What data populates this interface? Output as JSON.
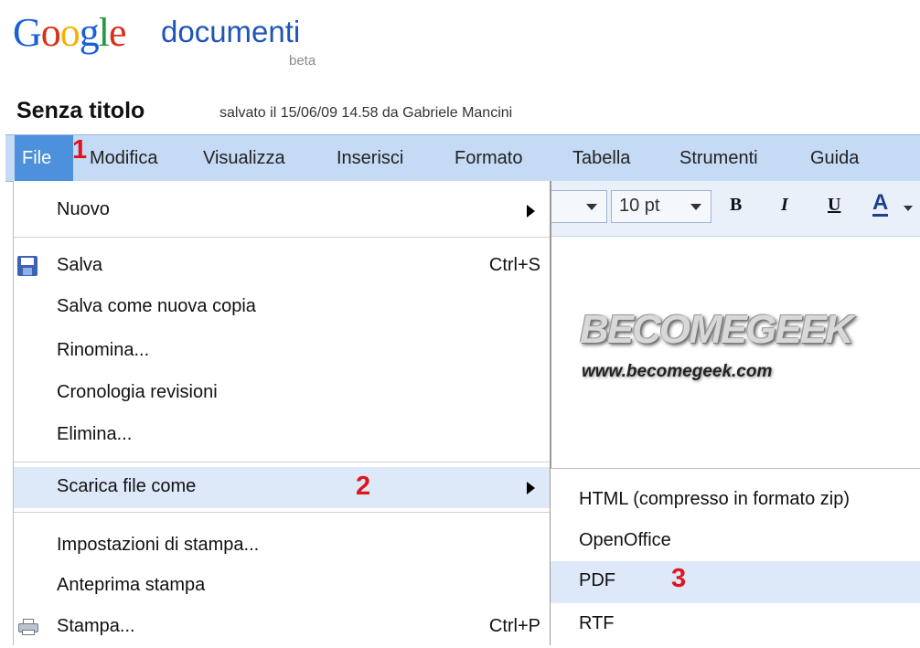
{
  "logo": {
    "google": [
      "G",
      "o",
      "o",
      "g",
      "l",
      "e"
    ],
    "product": "documenti",
    "beta": "beta"
  },
  "document": {
    "title": "Senza titolo",
    "saved_status": "salvato il 15/06/09 14.58 da Gabriele Mancini"
  },
  "menubar": {
    "items": [
      "File",
      "Modifica",
      "Visualizza",
      "Inserisci",
      "Formato",
      "Tabella",
      "Strumenti",
      "Guida"
    ],
    "active": "File"
  },
  "toolbar": {
    "font_size": "10 pt",
    "bold": "B",
    "italic": "I",
    "underline": "U",
    "text_color": "A"
  },
  "watermark": {
    "logo_text": "BECOMEGEEK",
    "url": "www.becomegeek.com"
  },
  "file_menu": {
    "nuovo": "Nuovo",
    "salva": "Salva",
    "salva_shortcut": "Ctrl+S",
    "salva_copia": "Salva come nuova copia",
    "rinomina": "Rinomina...",
    "cronologia": "Cronologia revisioni",
    "elimina": "Elimina...",
    "scarica": "Scarica file come",
    "impostazioni": "Impostazioni di stampa...",
    "anteprima": "Anteprima stampa",
    "stampa": "Stampa...",
    "stampa_shortcut": "Ctrl+P"
  },
  "download_submenu": {
    "html": "HTML (compresso in formato zip)",
    "openoffice": "OpenOffice",
    "pdf": "PDF",
    "rtf": "RTF"
  },
  "annotations": {
    "step1": "1",
    "step2": "2",
    "step3": "3"
  },
  "colors": {
    "menubar_bg": "#c5daf4",
    "active_menu": "#4d90db",
    "highlight": "#dde8f8",
    "annotation": "#e0141e"
  }
}
